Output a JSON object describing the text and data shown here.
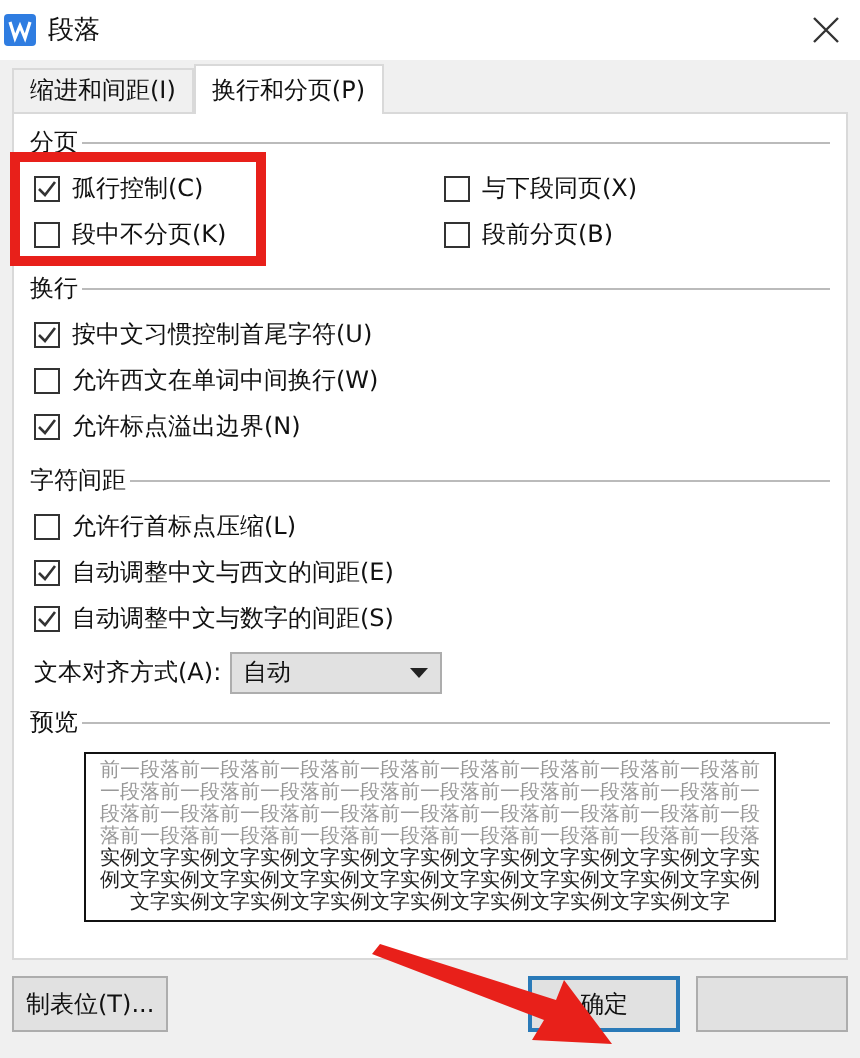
{
  "window": {
    "title": "段落"
  },
  "tabs": [
    {
      "label": "缩进和间距(I)",
      "selected": false
    },
    {
      "label": "换行和分页(P)",
      "selected": true
    }
  ],
  "sections": [
    {
      "title": "分页",
      "items": [
        {
          "label": "孤行控制(C)",
          "checked": true
        },
        {
          "label": "与下段同页(X)",
          "checked": false
        },
        {
          "label": "段中不分页(K)",
          "checked": false
        },
        {
          "label": "段前分页(B)",
          "checked": false
        }
      ]
    },
    {
      "title": "换行",
      "items": [
        {
          "label": "按中文习惯控制首尾字符(U)",
          "checked": true
        },
        {
          "label": "允许西文在单词中间换行(W)",
          "checked": false
        },
        {
          "label": "允许标点溢出边界(N)",
          "checked": true
        }
      ]
    },
    {
      "title": "字符间距",
      "items": [
        {
          "label": "允许行首标点压缩(L)",
          "checked": false
        },
        {
          "label": "自动调整中文与西文的间距(E)",
          "checked": true
        },
        {
          "label": "自动调整中文与数字的间距(S)",
          "checked": true
        }
      ]
    }
  ],
  "alignment": {
    "label": "文本对齐方式(A):",
    "value": "自动"
  },
  "preview": {
    "title": "预览",
    "previous_text": "前一段落前一段落前一段落前一段落前一段落前一段落前一段落前一段落前一段落前一段落前一段落前一段落前一段落前一段落前一段落前一段落前一段落前一段落前一段落前一段落前一段落前一段落前一段落前一段落前一段落前一段落前一段落前一段落前一段落前一段落前一段落前一段落前一段落",
    "sample_text": "实例文字实例文字实例文字实例文字实例文字实例文字实例文字实例文字实例文字实例文字实例文字实例文字实例文字实例文字实例文字实例文字实例文字实例文字实例文字实例文字实例文字实例文字实例文字实例文字"
  },
  "buttons": [
    {
      "label": "制表位(T)...",
      "kind": "plain"
    },
    {
      "label": "确定",
      "kind": "default"
    },
    {
      "kind": "plain"
    }
  ]
}
